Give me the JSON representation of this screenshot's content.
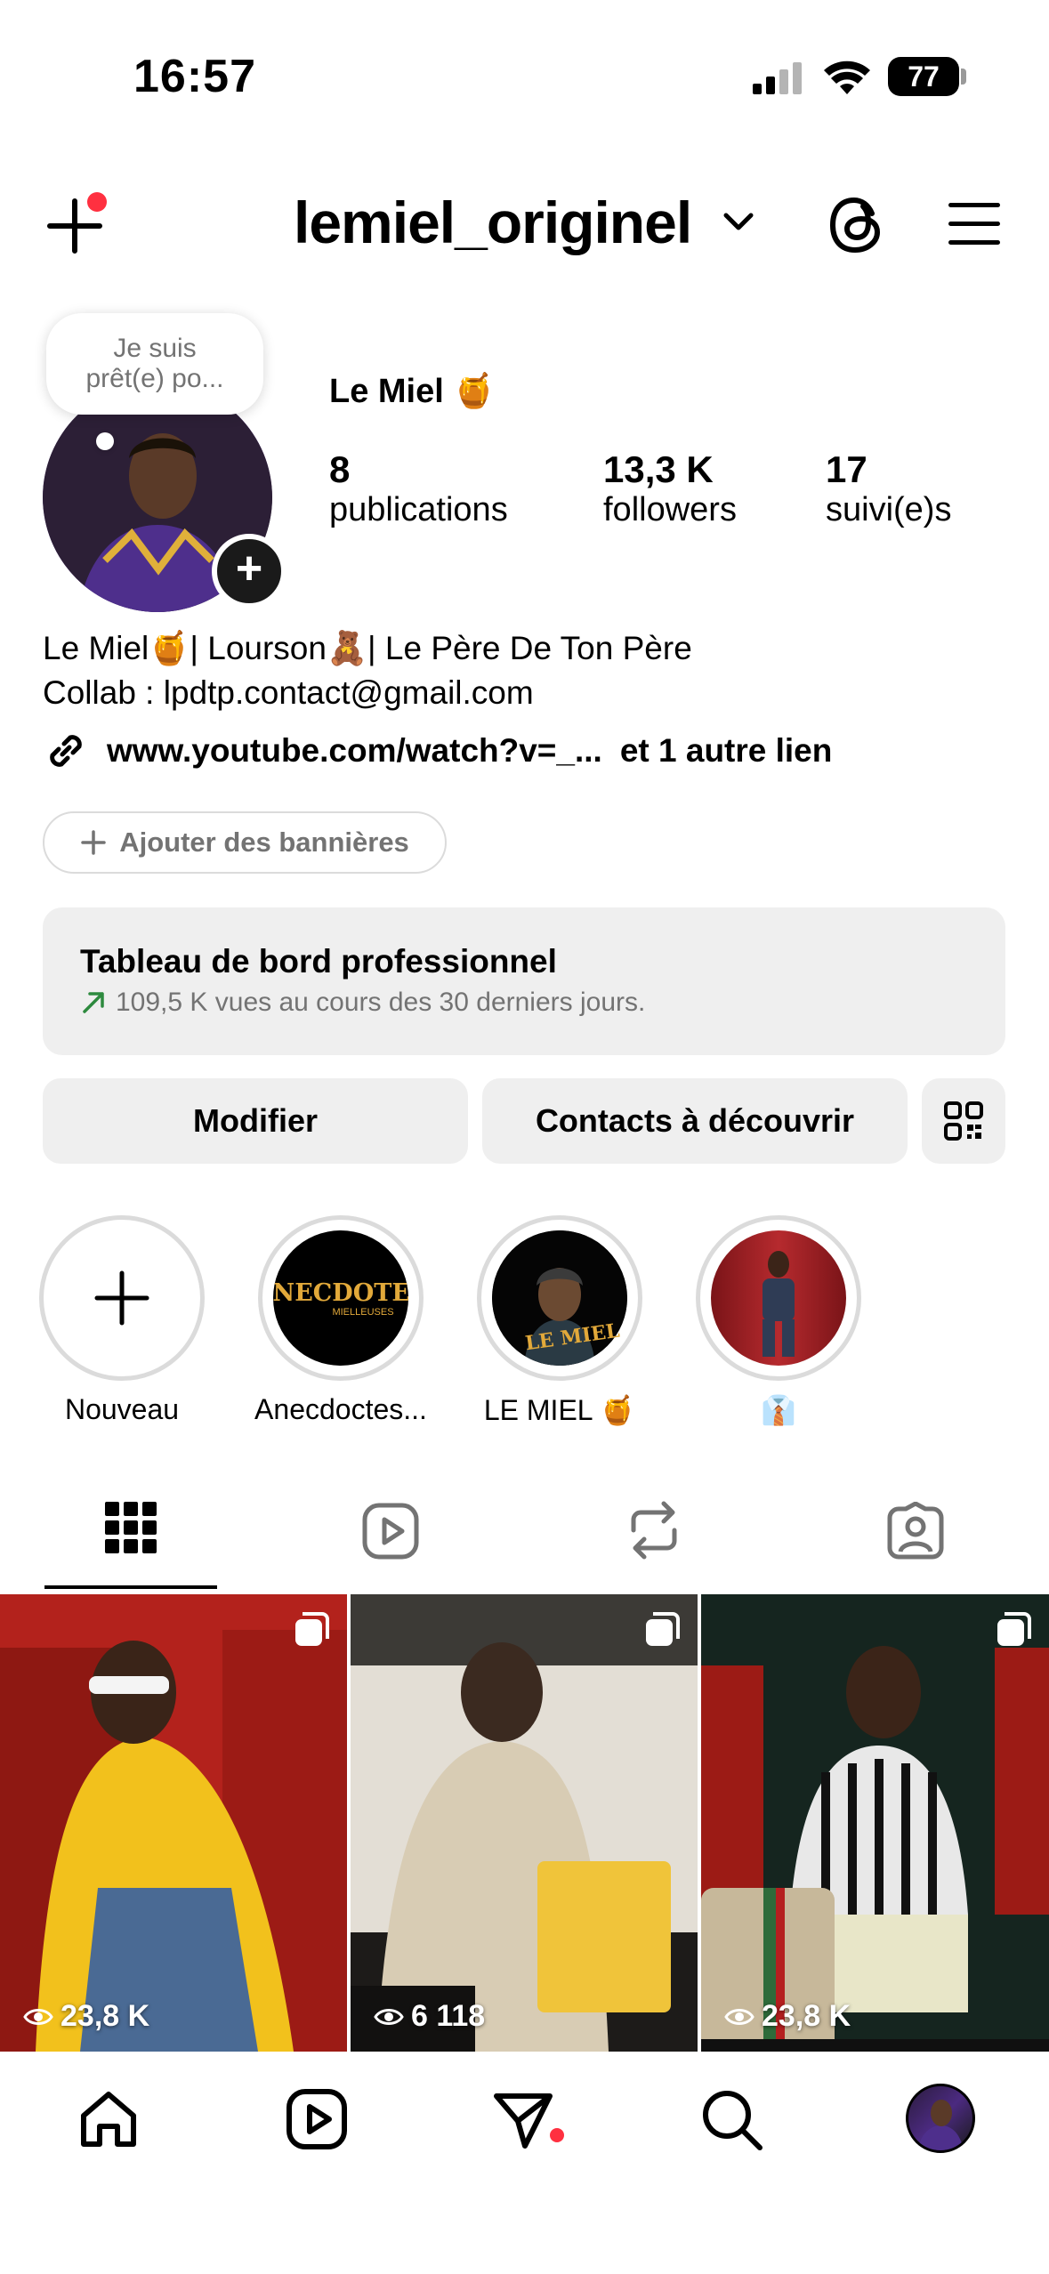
{
  "status_bar": {
    "time": "16:57",
    "battery": "77"
  },
  "header": {
    "username": "lemiel_originel"
  },
  "profile": {
    "note": [
      "Je suis",
      "prêt(e) po..."
    ],
    "display_name": "Le Miel 🍯",
    "stats": [
      {
        "value": "8",
        "label": "publications"
      },
      {
        "value": "13,3 K",
        "label": "followers"
      },
      {
        "value": "17",
        "label": "suivi(e)s"
      }
    ],
    "bio_lines": [
      "Le Miel🍯| Lourson🧸| Le Père De Ton Père",
      "Collab : lpdtp.contact@gmail.com"
    ],
    "link": "www.youtube.com/watch?v=_...",
    "link_more": "et 1 autre lien",
    "add_banners": "Ajouter des bannières"
  },
  "dashboard": {
    "title": "Tableau de bord professionnel",
    "subtitle": "109,5 K vues au cours des 30 derniers jours."
  },
  "actions": {
    "edit": "Modifier",
    "discover": "Contacts à découvrir"
  },
  "highlights": [
    {
      "label": "Nouveau"
    },
    {
      "label": "Anecdoctes...",
      "cover_text": "ANECDOTES",
      "cover_sub": "MIELLEUSES"
    },
    {
      "label": "LE MIEL 🍯",
      "cover_text": "LE MIEL"
    },
    {
      "label": "👔"
    }
  ],
  "posts": [
    {
      "views": "23,8 K",
      "bg": "#c0221b"
    },
    {
      "views": "6 118",
      "bg": "#e8e4dc"
    },
    {
      "views": "23,8 K",
      "bg": "#1d3a32"
    }
  ],
  "colors": {
    "accent_red": "#ff3040",
    "muted": "#737373",
    "chip_bg": "#efefef"
  }
}
